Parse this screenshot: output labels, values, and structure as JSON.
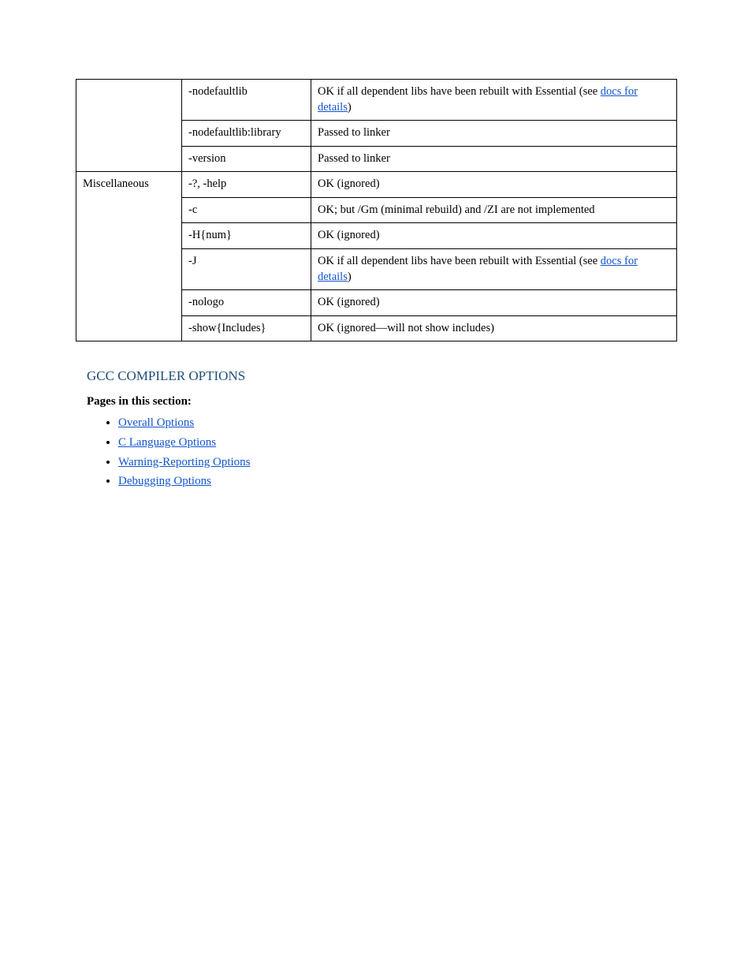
{
  "table": {
    "groups": [
      {
        "label": "",
        "rows": [
          {
            "name": "-nodefaultlib",
            "desc_pre": "OK if all dependent libs have been rebuilt with Essential (see ",
            "link_text": "docs for details",
            "desc_post": ")"
          },
          {
            "name": "-nodefaultlib:library",
            "plain": "Passed to linker"
          },
          {
            "name": "-version",
            "plain": "Passed to linker"
          }
        ]
      },
      {
        "label": "Miscellaneous",
        "rows": [
          {
            "name": "-?, -help",
            "plain": "OK (ignored)"
          },
          {
            "name": "-c",
            "plain": "OK; but /Gm (minimal rebuild) and /ZI are not implemented"
          },
          {
            "name": "-H{num}",
            "plain": "OK (ignored)"
          },
          {
            "name": "-J",
            "desc_pre": "OK if all dependent libs have been rebuilt with Essential (see ",
            "link_text": "docs for details",
            "desc_post": ")"
          },
          {
            "name": "-nologo",
            "plain": "OK (ignored)"
          },
          {
            "name": "-show{Includes}",
            "plain": "OK (ignored—will not show includes)"
          }
        ]
      }
    ]
  },
  "sectionTitle": "GCC COMPILER OPTIONS",
  "pageHeading": "Pages in this section:",
  "links": [
    "Overall Options",
    "C Language Options",
    "Warning-Reporting Options",
    "Debugging Options"
  ]
}
